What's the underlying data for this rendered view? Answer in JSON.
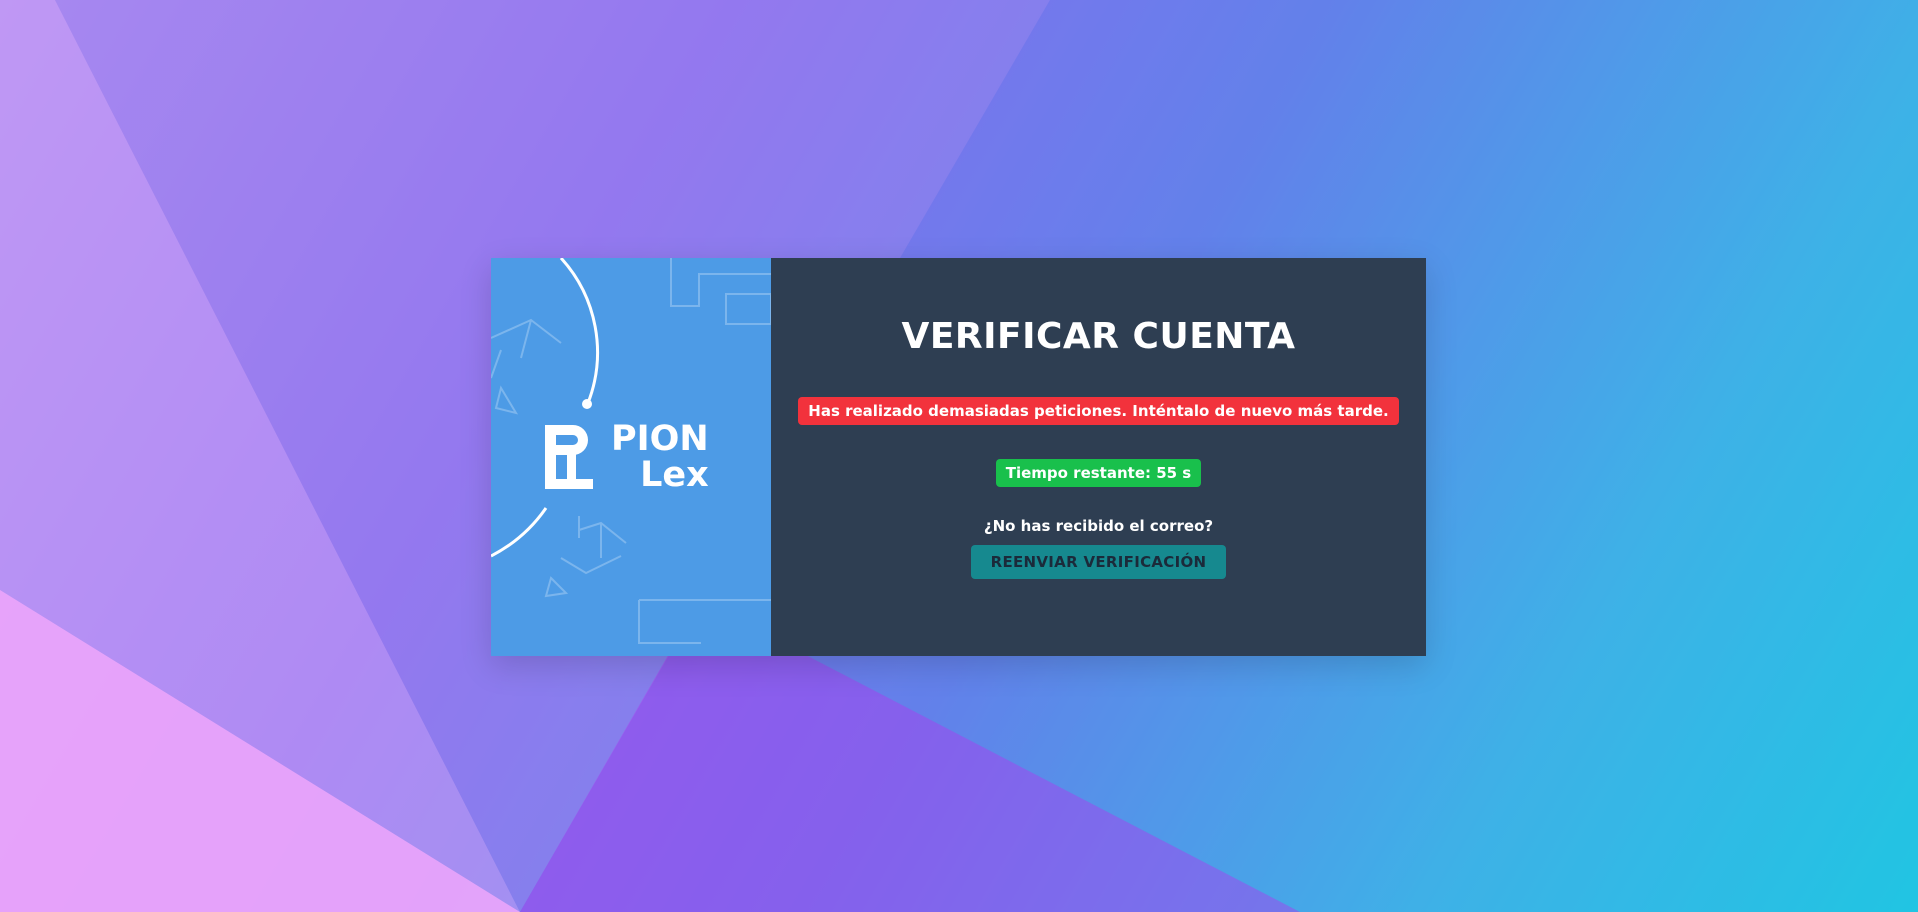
{
  "brand": {
    "line1": "PION",
    "line2": "Lex",
    "icon": "pionlex-logo"
  },
  "verify": {
    "title": "VERIFICAR CUENTA",
    "error_message": "Has realizado demasiadas peticiones. Inténtalo de nuevo más tarde.",
    "timer_text": "Tiempo restante: 55 s",
    "question": "¿No has recibido el correo?",
    "resend_label": "REENVIAR VERIFICACIÓN"
  },
  "colors": {
    "left_panel": "#4d9be6",
    "right_panel": "#2e3e52",
    "error": "#f2323c",
    "success": "#19c04c",
    "button": "#16898f"
  }
}
